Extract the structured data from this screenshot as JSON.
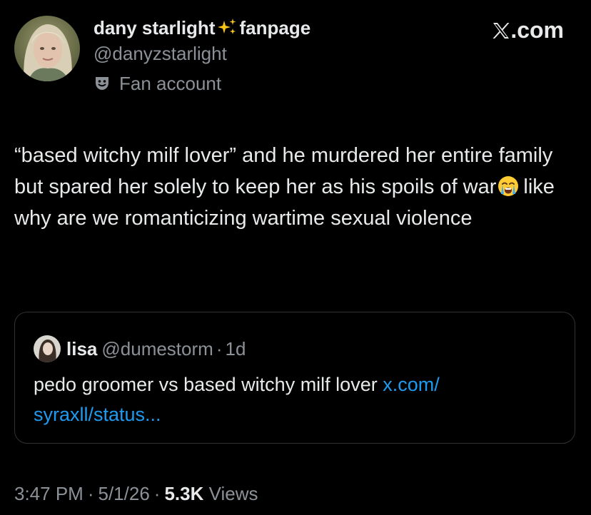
{
  "author": {
    "name_part1": "dany starlight",
    "name_part2": "fanpage",
    "sparkles_icon": "sparkles-emoji",
    "handle": "@danyzstarlight",
    "label": "Fan account",
    "label_icon": "theater-mask-icon"
  },
  "brand": {
    "text": ".com",
    "logo_icon": "x-logo-icon"
  },
  "tweet": {
    "text_part1": "“based witchy milf lover” and he murdered her entire family but spared her solely to keep her as his spoils of war",
    "emoji": "loudly-crying-face-emoji",
    "text_part2": "like why are we romanticizing wartime sexual violence"
  },
  "quote": {
    "name": "lisa",
    "handle": "@dumestorm",
    "separator": "·",
    "time": "1d",
    "text": "pedo groomer vs based witchy milf lover",
    "link_part1": "x.com/",
    "link_part2": "syraxll/status..."
  },
  "footer": {
    "time": "3:47 PM",
    "sep1": "·",
    "date": "5/1/26",
    "sep2": "·",
    "views_count": "5.3K",
    "views_label": "Views"
  },
  "colors": {
    "background": "#000000",
    "text_primary": "#e7e9ea",
    "text_secondary": "#8b9197",
    "link": "#1d9bf0",
    "border": "#2f3336"
  }
}
